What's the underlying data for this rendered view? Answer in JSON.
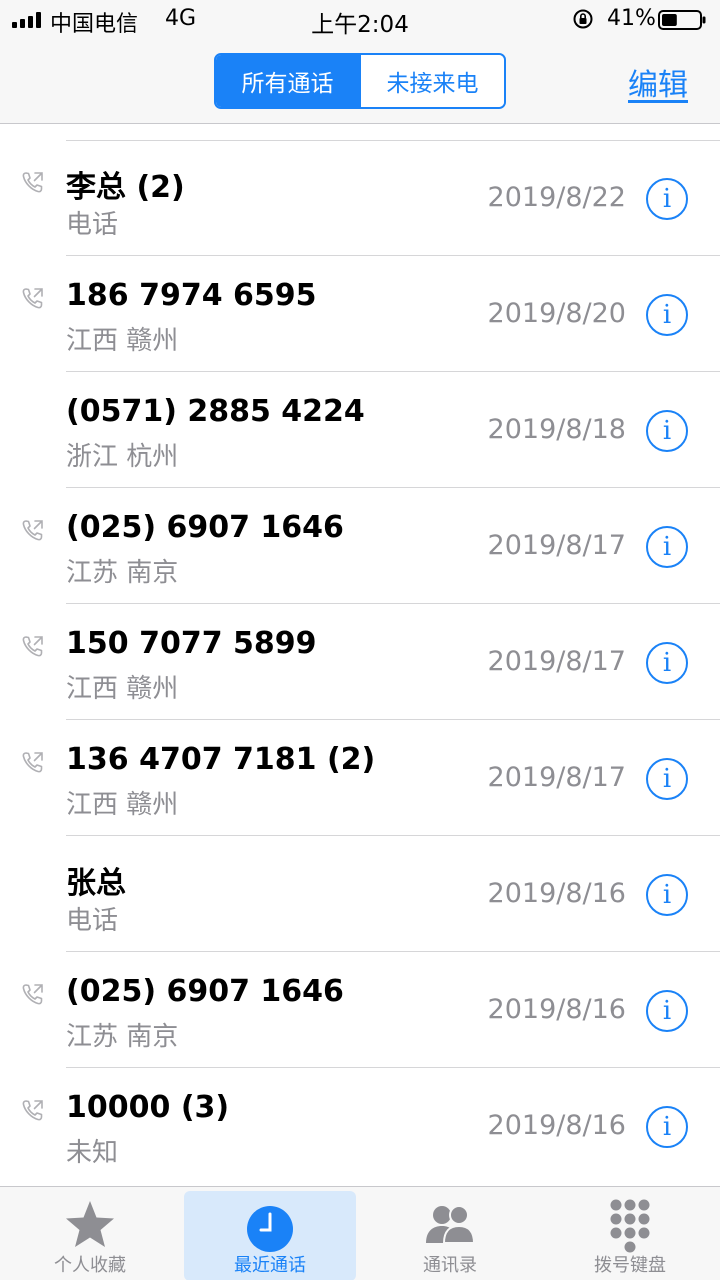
{
  "status_bar": {
    "carrier": "中国电信",
    "network": "4G",
    "time": "上午2:04",
    "battery_percent": "41%",
    "battery_level": 0.41
  },
  "nav": {
    "segments": [
      "所有通话",
      "未接来电"
    ],
    "active_segment": 0,
    "edit_label": "编辑"
  },
  "calls": [
    {
      "name": "李总 (2)",
      "subtitle": "电话",
      "date": "2019/8/22",
      "outgoing": true
    },
    {
      "name": "186 7974 6595",
      "subtitle": "江西 赣州",
      "date": "2019/8/20",
      "outgoing": true
    },
    {
      "name": "(0571) 2885 4224",
      "subtitle": "浙江 杭州",
      "date": "2019/8/18",
      "outgoing": false
    },
    {
      "name": "(025) 6907 1646",
      "subtitle": "江苏 南京",
      "date": "2019/8/17",
      "outgoing": true
    },
    {
      "name": "150 7077 5899",
      "subtitle": "江西 赣州",
      "date": "2019/8/17",
      "outgoing": true
    },
    {
      "name": "136 4707 7181 (2)",
      "subtitle": "江西 赣州",
      "date": "2019/8/17",
      "outgoing": true
    },
    {
      "name": "张总",
      "subtitle": "电话",
      "date": "2019/8/16",
      "outgoing": false
    },
    {
      "name": "(025) 6907 1646",
      "subtitle": "江苏 南京",
      "date": "2019/8/16",
      "outgoing": true
    },
    {
      "name": "10000 (3)",
      "subtitle": "未知",
      "date": "2019/8/16",
      "outgoing": true
    }
  ],
  "info_glyph": "i",
  "tabs": [
    {
      "label": "个人收藏",
      "icon": "star-icon"
    },
    {
      "label": "最近通话",
      "icon": "clock-icon",
      "active": true
    },
    {
      "label": "通讯录",
      "icon": "contacts-icon"
    },
    {
      "label": "拨号键盘",
      "icon": "keypad-icon"
    }
  ],
  "colors": {
    "accent": "#1a82f7",
    "secondary_text": "#8e8e93",
    "bar_bg": "#f7f7f7",
    "tab_icon_gray": "#8e8e93"
  }
}
